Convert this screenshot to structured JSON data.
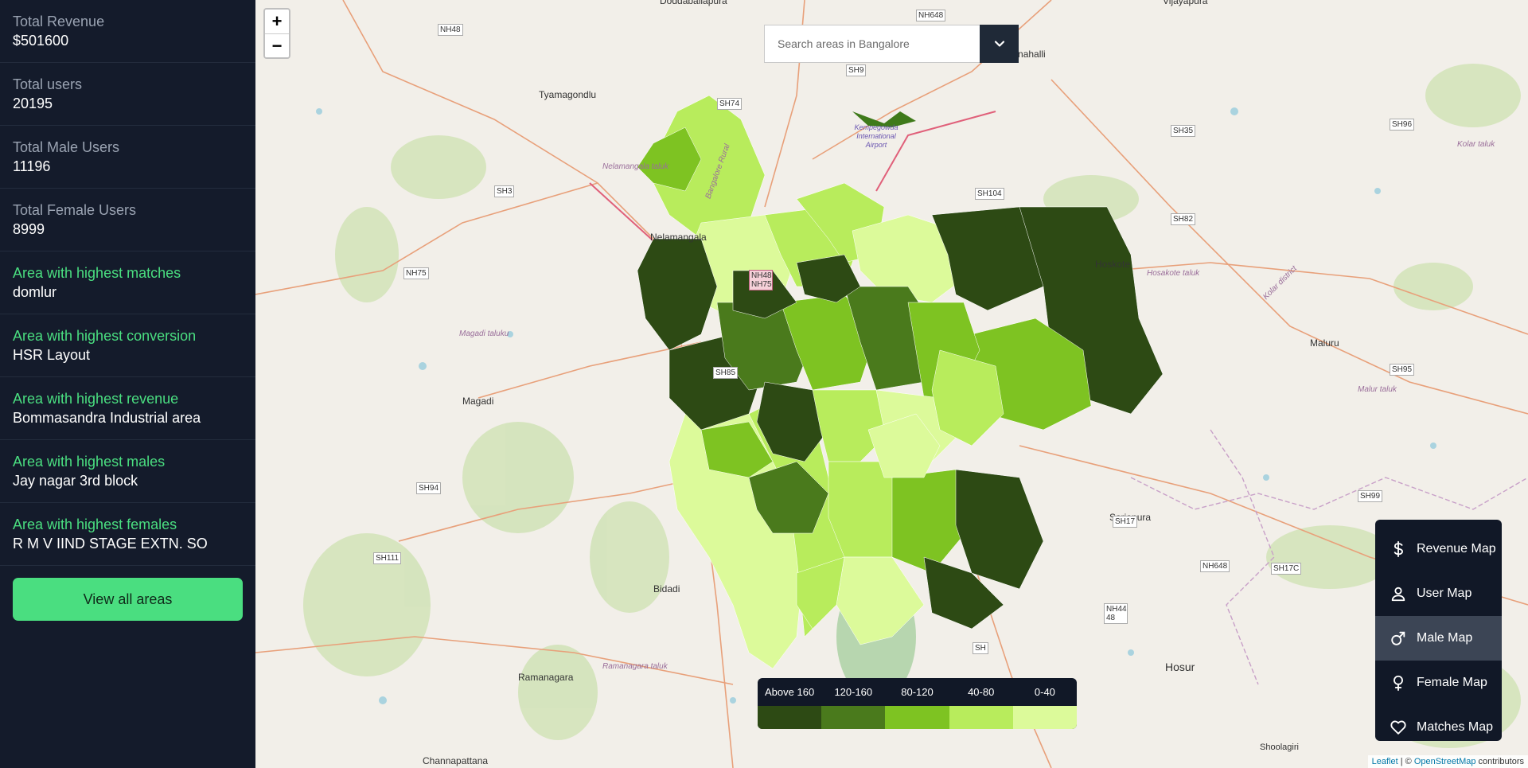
{
  "sidebar": {
    "stats": [
      {
        "label": "Total Revenue",
        "value": "$501600"
      },
      {
        "label": "Total users",
        "value": "20195"
      },
      {
        "label": "Total Male Users",
        "value": "11196"
      },
      {
        "label": "Total Female Users",
        "value": "8999"
      },
      {
        "label": "Area with highest matches",
        "value": "domlur"
      },
      {
        "label": "Area with highest conversion",
        "value": "HSR Layout"
      },
      {
        "label": "Area with highest revenue",
        "value": "Bommasandra Industrial area"
      },
      {
        "label": "Area with highest males",
        "value": "Jay nagar 3rd block"
      },
      {
        "label": "Area with highest females",
        "value": "R M V IIND STAGE EXTN. SO"
      }
    ],
    "view_all_label": "View all areas"
  },
  "map": {
    "zoom_in": "+",
    "zoom_out": "−",
    "search_placeholder": "Search areas in Bangalore",
    "legend": {
      "labels": [
        "Above 160",
        "120-160",
        "80-120",
        "40-80",
        "0-40"
      ],
      "colors": [
        "#2d4a14",
        "#4a7a1c",
        "#7ec322",
        "#b8ec5c",
        "#dcfa9a"
      ]
    },
    "menu": [
      {
        "label": "Revenue Map",
        "icon": "dollar-icon",
        "active": false
      },
      {
        "label": "User Map",
        "icon": "user-icon",
        "active": false
      },
      {
        "label": "Male Map",
        "icon": "male-icon",
        "active": true
      },
      {
        "label": "Female Map",
        "icon": "female-icon",
        "active": false
      },
      {
        "label": "Matches Map",
        "icon": "heart-icon",
        "active": false
      }
    ],
    "place_labels": [
      "Doddaballapura",
      "Vijayapura",
      "Devanahalli",
      "Tyamagondlu",
      "Nelamangala",
      "Nelamangala taluk",
      "Bangalore Rural",
      "Hoskote",
      "Hosakote taluk",
      "Kolar district",
      "Maluru",
      "Malur taluk",
      "Kolar taluk",
      "Magadi",
      "Magadi taluku",
      "Bidadi",
      "Ramanagara",
      "Ramanagara taluk",
      "Channapattana",
      "Sarjapura",
      "Hosur",
      "Shoolagiri",
      "Kempegowda International Airport"
    ],
    "road_labels": [
      "NH48",
      "NH648",
      "SH9",
      "SH74",
      "SH35",
      "SH96",
      "SH3",
      "SH104",
      "SH82",
      "NH75",
      "NH48 NH75",
      "SH85",
      "SH95",
      "SH94",
      "SH111",
      "SH99",
      "SH17",
      "SH17C",
      "NH648",
      "NH44 48",
      "SH"
    ],
    "attribution": {
      "leaflet": "Leaflet",
      "sep": " | © ",
      "osm": "OpenStreetMap",
      "suffix": " contributors"
    }
  }
}
